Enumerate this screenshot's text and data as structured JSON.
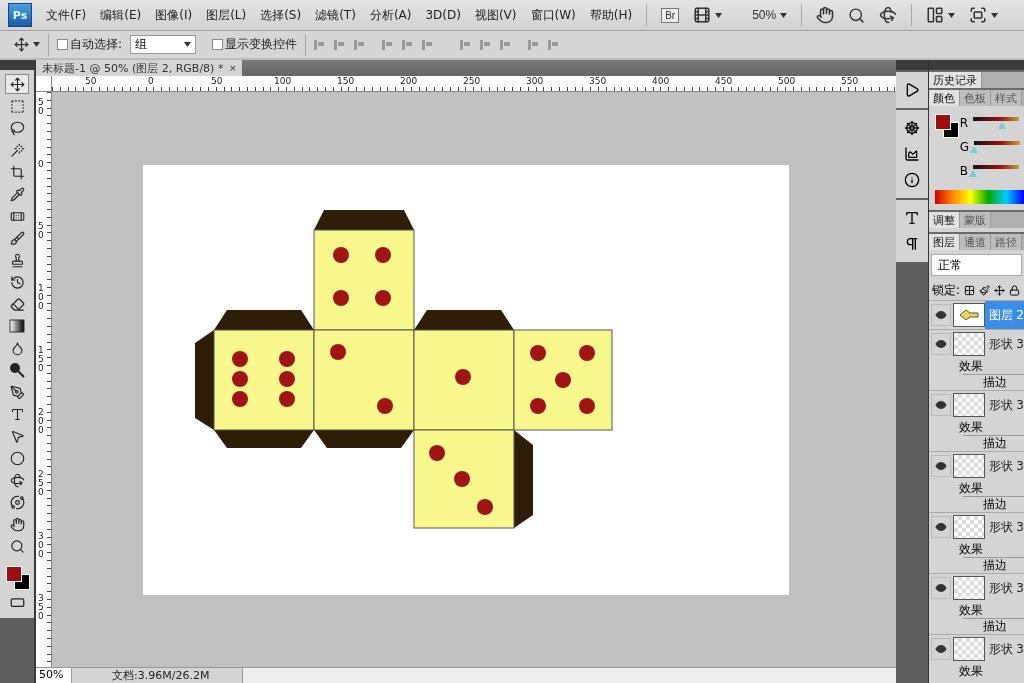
{
  "app": {
    "logo": "Ps",
    "bridge": "Br",
    "zoom": "50%"
  },
  "menu": [
    "文件(F)",
    "编辑(E)",
    "图像(I)",
    "图层(L)",
    "选择(S)",
    "滤镜(T)",
    "分析(A)",
    "3D(D)",
    "视图(V)",
    "窗口(W)",
    "帮助(H)"
  ],
  "options_bar": {
    "auto_select": {
      "label": "自动选择:",
      "checked": false
    },
    "auto_select_target": "组",
    "show_transform": {
      "label": "显示变换控件",
      "checked": false
    }
  },
  "tools": [
    {
      "kind": "move",
      "selected": true
    },
    {
      "kind": "marquee",
      "selected": false
    },
    {
      "kind": "lasso",
      "selected": false
    },
    {
      "kind": "wand",
      "selected": false
    },
    {
      "kind": "crop",
      "selected": false
    },
    {
      "kind": "eyedropper",
      "selected": false
    },
    {
      "kind": "heal",
      "selected": false
    },
    {
      "kind": "brush",
      "selected": false
    },
    {
      "kind": "stamp",
      "selected": false
    },
    {
      "kind": "history",
      "selected": false
    },
    {
      "kind": "eraser",
      "selected": false
    },
    {
      "kind": "gradient",
      "selected": false
    },
    {
      "kind": "blur",
      "selected": false
    },
    {
      "kind": "dodge",
      "selected": false
    },
    {
      "kind": "pen",
      "selected": false
    },
    {
      "kind": "type",
      "selected": false
    },
    {
      "kind": "select",
      "selected": false
    },
    {
      "kind": "ellipse",
      "selected": false
    },
    {
      "kind": "rotate3d",
      "selected": false
    },
    {
      "kind": "orbit",
      "selected": false
    },
    {
      "kind": "hand",
      "selected": false
    },
    {
      "kind": "zoom",
      "selected": false
    }
  ],
  "document": {
    "tab": "未标题-1 @ 50% (图层 2, RGB/8) *",
    "close": "×",
    "horizontal_ruler": [
      "50",
      "0",
      "50",
      "100",
      "150",
      "200",
      "250",
      "300",
      "350",
      "400",
      "450",
      "500",
      "550"
    ],
    "vertical_ruler": [
      "50",
      "0",
      "50",
      "100",
      "150",
      "200",
      "250",
      "300",
      "350"
    ]
  },
  "status_bar": {
    "zoom": "50%",
    "doc_info": "文档:3.96M/26.2M"
  },
  "panels": {
    "history_tabs": [
      {
        "label": "历史记录",
        "selected": true
      }
    ],
    "color_tabs": [
      {
        "label": "颜色",
        "selected": true
      },
      {
        "label": "色板",
        "selected": false
      },
      {
        "label": "样式",
        "selected": false
      }
    ],
    "channels": [
      {
        "label": "R",
        "level": 0.63
      },
      {
        "label": "G",
        "level": 0
      },
      {
        "label": "B",
        "level": 0
      }
    ],
    "adjust_tabs": [
      {
        "label": "调整",
        "selected": true
      },
      {
        "label": "蒙版",
        "selected": false
      }
    ],
    "layer_tabs": [
      {
        "label": "图层",
        "selected": true
      },
      {
        "label": "通道",
        "selected": false
      },
      {
        "label": "路径",
        "selected": false
      }
    ],
    "blend_mode": "正常",
    "lock_label": "锁定:",
    "layers": [
      {
        "name": "图层 2",
        "selected": true,
        "visible": true
      },
      {
        "name": "形状 3",
        "selected": false,
        "visible": true,
        "effects_label": "效果",
        "effects": [
          "描边"
        ]
      },
      {
        "name": "形状 3",
        "selected": false,
        "visible": true,
        "effects_label": "效果",
        "effects": [
          "描边"
        ]
      },
      {
        "name": "形状 3",
        "selected": false,
        "visible": true,
        "effects_label": "效果",
        "effects": [
          "描边"
        ]
      },
      {
        "name": "形状 3",
        "selected": false,
        "visible": true,
        "effects_label": "效果",
        "effects": [
          "描边"
        ]
      },
      {
        "name": "形状 3",
        "selected": false,
        "visible": true,
        "effects_label": "效果",
        "effects": [
          "描边"
        ]
      },
      {
        "name": "形状 3",
        "selected": false,
        "visible": true,
        "effects_label": "效果"
      }
    ]
  }
}
